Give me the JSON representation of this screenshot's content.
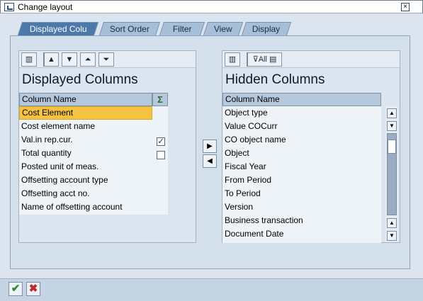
{
  "window": {
    "title": "Change layout",
    "close": "×"
  },
  "tabs": [
    {
      "label": "Displayed Colu"
    },
    {
      "label": "Sort Order"
    },
    {
      "label": "Filter"
    },
    {
      "label": "View"
    },
    {
      "label": "Display"
    }
  ],
  "displayed": {
    "title": "Displayed Columns",
    "header": "Column Name",
    "sum_icon": "Σ",
    "rows": [
      {
        "label": "Cost Element",
        "selected": true
      },
      {
        "label": "Cost element name"
      },
      {
        "label": "Val.in rep.cur.",
        "sum": "checked"
      },
      {
        "label": "Total quantity",
        "sum": "unchecked"
      },
      {
        "label": "Posted unit of meas."
      },
      {
        "label": "Offsetting account type"
      },
      {
        "label": "Offsetting acct no."
      },
      {
        "label": "Name of offsetting account"
      }
    ]
  },
  "hidden": {
    "title": "Hidden Columns",
    "header": "Column Name",
    "filter_all": "All",
    "rows": [
      {
        "label": "Object type"
      },
      {
        "label": "Value COCurr"
      },
      {
        "label": "CO object name"
      },
      {
        "label": "Object"
      },
      {
        "label": "Fiscal Year"
      },
      {
        "label": "From Period"
      },
      {
        "label": "To Period"
      },
      {
        "label": "Version"
      },
      {
        "label": "Business transaction"
      },
      {
        "label": "Document Date"
      }
    ]
  },
  "icons": {
    "find": "find-icon",
    "up": "move-up-icon",
    "down": "move-down-icon",
    "top": "move-top-icon",
    "bottom": "move-bottom-icon",
    "filter": "filter-icon",
    "move_right": "move-right-icon",
    "move_left": "move-left-icon",
    "confirm": "confirm-icon",
    "cancel": "cancel-icon"
  },
  "colors": {
    "tab_active": "#4d79aa",
    "selection": "#f5c242",
    "confirm": "#2e8b2e",
    "cancel": "#c0282a"
  }
}
